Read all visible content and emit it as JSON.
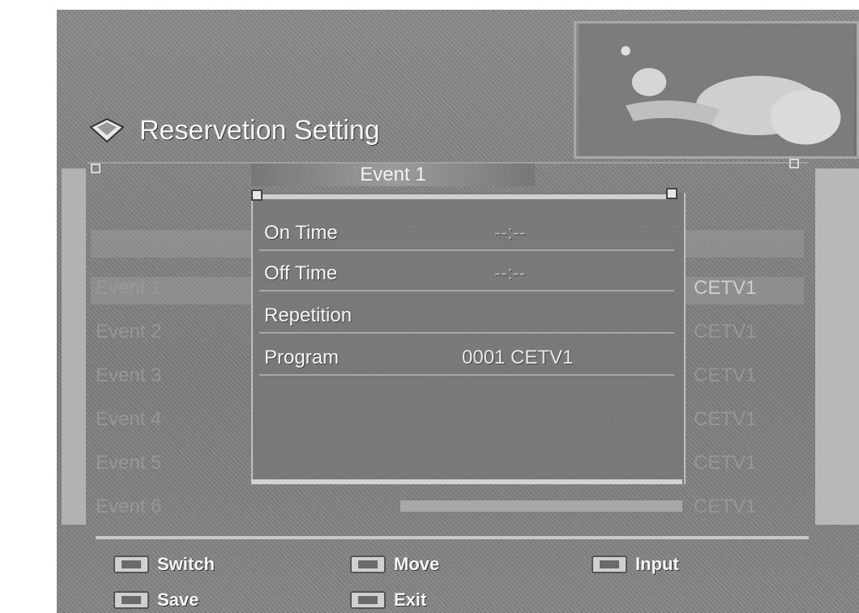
{
  "title": "Reservetion Setting",
  "popup": {
    "header": "Event 1",
    "fields": [
      {
        "label": "On Time",
        "value": "--:--"
      },
      {
        "label": "Off Time",
        "value": "--:--"
      },
      {
        "label": "Repetition",
        "value": ""
      },
      {
        "label": "Program",
        "value": "0001 CETV1"
      }
    ]
  },
  "background_list": {
    "events": [
      "Event 1",
      "Event 2",
      "Event 3",
      "Event 4",
      "Event 5",
      "Event 6"
    ],
    "channels": [
      "CETV1",
      "CETV1",
      "CETV1",
      "CETV1",
      "CETV1",
      "CETV1"
    ]
  },
  "hints": {
    "switch": "Switch",
    "move": "Move",
    "input": "Input",
    "save": "Save",
    "exit": "Exit"
  },
  "icons": {
    "title": "reservation-icon",
    "keys": [
      "arrow-left-right-key-icon",
      "arrow-up-down-key-icon",
      "number-key-icon",
      "menu-key-icon",
      "exit-key-icon"
    ]
  }
}
